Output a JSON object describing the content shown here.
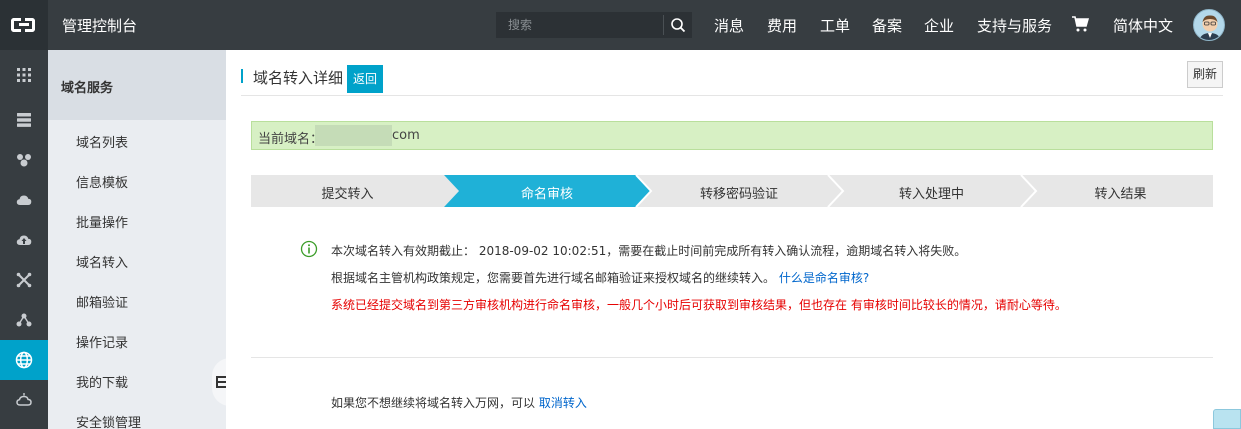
{
  "header": {
    "title": "管理控制台",
    "search_placeholder": "搜索",
    "nav": [
      "消息",
      "费用",
      "工单",
      "备案",
      "企业",
      "支持与服务"
    ],
    "language": "简体中文"
  },
  "rail": {
    "icons": [
      "grid-icon",
      "server-icon",
      "cluster-icon",
      "cloud-icon",
      "cloud-upload-icon",
      "crossing-icon",
      "network-icon",
      "globe-icon",
      "gear-cloud-icon"
    ],
    "active_index": 7,
    "active_color": "#00a2ca"
  },
  "sidebar": {
    "heading": "域名服务",
    "items": [
      "域名列表",
      "信息模板",
      "批量操作",
      "域名转入",
      "邮箱验证",
      "操作记录",
      "我的下载",
      "安全锁管理"
    ]
  },
  "main": {
    "title": "域名转入详细",
    "back_label": "返回",
    "refresh_label": "刷新",
    "domain_label": "当前域名：",
    "domain_suffix": "com",
    "steps": [
      "提交转入",
      "命名审核",
      "转移密码验证",
      "转入处理中",
      "转入结果"
    ],
    "active_step": 1,
    "message1": "本次域名转入有效期截止： 2018-09-02 10:02:51，需要在截止时间前完成所有转入确认流程，逾期域名转入将失败。",
    "message2_text": "根据域名主管机构政策规定，您需要首先进行域名邮箱验证来授权域名的继续转入。",
    "message2_link": "什么是命名审核?",
    "message3": "系统已经提交域名到第三方审核机构进行命名审核，一般几个小时后可获取到审核结果，但也存在 有审核时间比较长的情况，请耐心等待。",
    "cancel_text": "如果您不想继续将域名转入万网，可以",
    "cancel_link": "取消转入"
  },
  "colors": {
    "topbar": "#373d41",
    "accent": "#00a2ca",
    "domain_bar": "#d7f0c4",
    "warning_text": "#e60000",
    "link": "#0066cc",
    "step_inactive": "#e7e7e7"
  }
}
